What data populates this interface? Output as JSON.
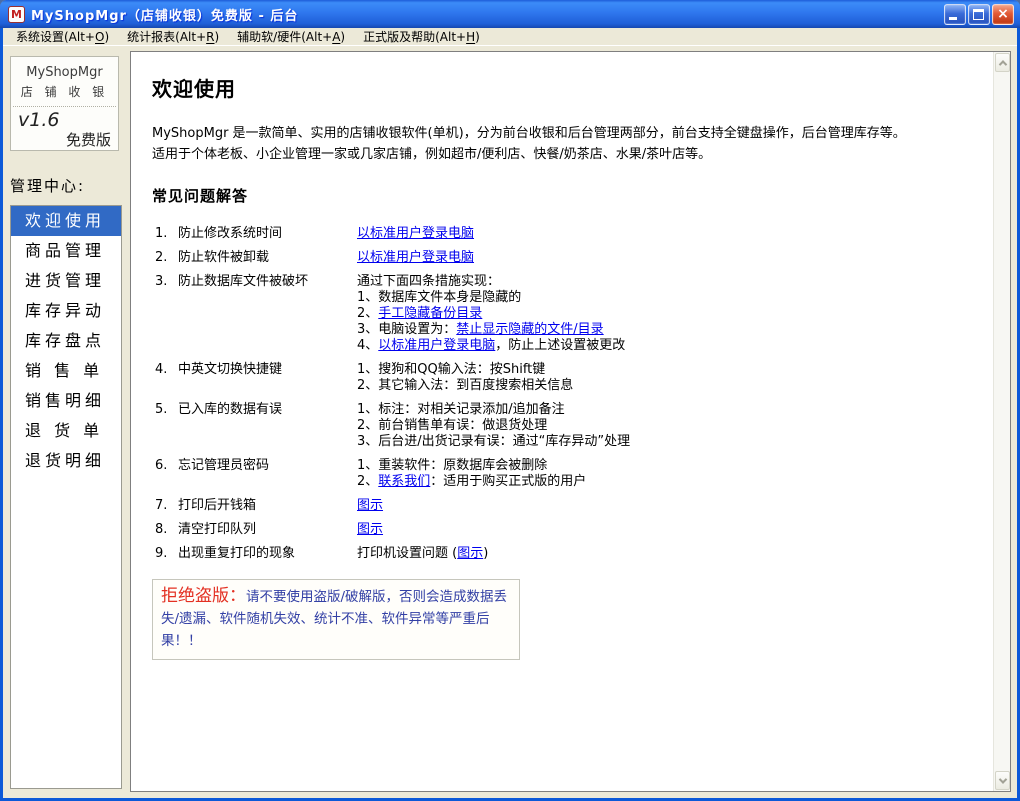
{
  "window": {
    "title": "MyShopMgr（店铺收银）免费版 - 后台",
    "app_icon": "M"
  },
  "colors": {
    "titlebar_blue": "#2F77EE",
    "chrome_beige": "#ECE9D8",
    "selection_blue": "#316AC5",
    "link_blue": "#0000EE",
    "warning_red": "#E33022",
    "warning_blue": "#3340A5"
  },
  "menubar": {
    "items": [
      {
        "id": "system-settings",
        "pre": "系统设置(Alt+",
        "accel": "O",
        "post": ")"
      },
      {
        "id": "stats-reports",
        "pre": "统计报表(Alt+",
        "accel": "R",
        "post": ")"
      },
      {
        "id": "aux-soft-hardware",
        "pre": "辅助软/硬件(Alt+",
        "accel": "A",
        "post": ")"
      },
      {
        "id": "official-help",
        "pre": "正式版及帮助(Alt+",
        "accel": "H",
        "post": ")"
      }
    ]
  },
  "sidebar": {
    "logo": {
      "line1": "MyShopMgr",
      "line2": "店 铺 收 银",
      "version": "v1.6",
      "edition": "免费版"
    },
    "label": "管理中心:",
    "items": [
      {
        "id": "welcome",
        "label": "欢迎使用",
        "selected": true
      },
      {
        "id": "goods",
        "label": "商品管理"
      },
      {
        "id": "purchase",
        "label": "进货管理"
      },
      {
        "id": "stock-change",
        "label": "库存异动"
      },
      {
        "id": "stock-check",
        "label": "库存盘点"
      },
      {
        "id": "sales-order",
        "label": "销 售 单"
      },
      {
        "id": "sales-detail",
        "label": "销售明细"
      },
      {
        "id": "return-order",
        "label": "退 货 单"
      },
      {
        "id": "return-detail",
        "label": "退货明细"
      }
    ]
  },
  "main": {
    "heading": "欢迎使用",
    "intro": "MyShopMgr 是一款简单、实用的店铺收银软件(单机)，分为前台收银和后台管理两部分，前台支持全键盘操作，后台管理库存等。适用于个体老板、小企业管理一家或几家店铺，例如超市/便利店、快餐/奶茶店、水果/茶叶店等。",
    "faq_heading": "常见问题解答",
    "faq": [
      {
        "num": "1.",
        "question": "防止修改系统时间",
        "answers": [
          [
            {
              "t": "以标准用户登录电脑",
              "link": true
            }
          ]
        ]
      },
      {
        "num": "2.",
        "question": "防止软件被卸载",
        "answers": [
          [
            {
              "t": "以标准用户登录电脑",
              "link": true
            }
          ]
        ]
      },
      {
        "num": "3.",
        "question": "防止数据库文件被破坏",
        "answers": [
          [
            {
              "t": "通过下面四条措施实现："
            }
          ],
          [
            {
              "t": "1、数据库文件本身是隐藏的"
            }
          ],
          [
            {
              "t": "2、"
            },
            {
              "t": "手工隐藏备份目录",
              "link": true
            }
          ],
          [
            {
              "t": "3、电脑设置为："
            },
            {
              "t": "禁止显示隐藏的文件/目录",
              "link": true
            }
          ],
          [
            {
              "t": "4、"
            },
            {
              "t": "以标准用户登录电脑",
              "link": true
            },
            {
              "t": "，防止上述设置被更改"
            }
          ]
        ]
      },
      {
        "num": "4.",
        "question": "中英文切换快捷键",
        "answers": [
          [
            {
              "t": "1、搜狗和QQ输入法：按Shift键"
            }
          ],
          [
            {
              "t": "2、其它输入法：到百度搜索相关信息"
            }
          ]
        ]
      },
      {
        "num": "5.",
        "question": "已入库的数据有误",
        "answers": [
          [
            {
              "t": "1、标注：对相关记录添加/追加备注"
            }
          ],
          [
            {
              "t": "2、前台销售单有误：做退货处理"
            }
          ],
          [
            {
              "t": "3、后台进/出货记录有误：通过“库存异动”处理"
            }
          ]
        ]
      },
      {
        "num": "6.",
        "question": "忘记管理员密码",
        "answers": [
          [
            {
              "t": "1、重装软件：原数据库会被删除"
            }
          ],
          [
            {
              "t": "2、"
            },
            {
              "t": "联系我们",
              "link": true
            },
            {
              "t": "：适用于购买正式版的用户"
            }
          ]
        ]
      },
      {
        "num": "7.",
        "question": "打印后开钱箱",
        "answers": [
          [
            {
              "t": "图示",
              "link": true
            }
          ]
        ]
      },
      {
        "num": "8.",
        "question": "清空打印队列",
        "answers": [
          [
            {
              "t": "图示",
              "link": true
            }
          ]
        ]
      },
      {
        "num": "9.",
        "question": "出现重复打印的现象",
        "answers": [
          [
            {
              "t": "打印机设置问题 ("
            },
            {
              "t": "图示",
              "link": true
            },
            {
              "t": ")"
            }
          ]
        ]
      }
    ],
    "warning": {
      "label": "拒绝盗版：",
      "text": "请不要使用盗版/破解版，否则会造成数据丢失/遗漏、软件随机失效、统计不准、软件异常等严重后果！！"
    }
  }
}
